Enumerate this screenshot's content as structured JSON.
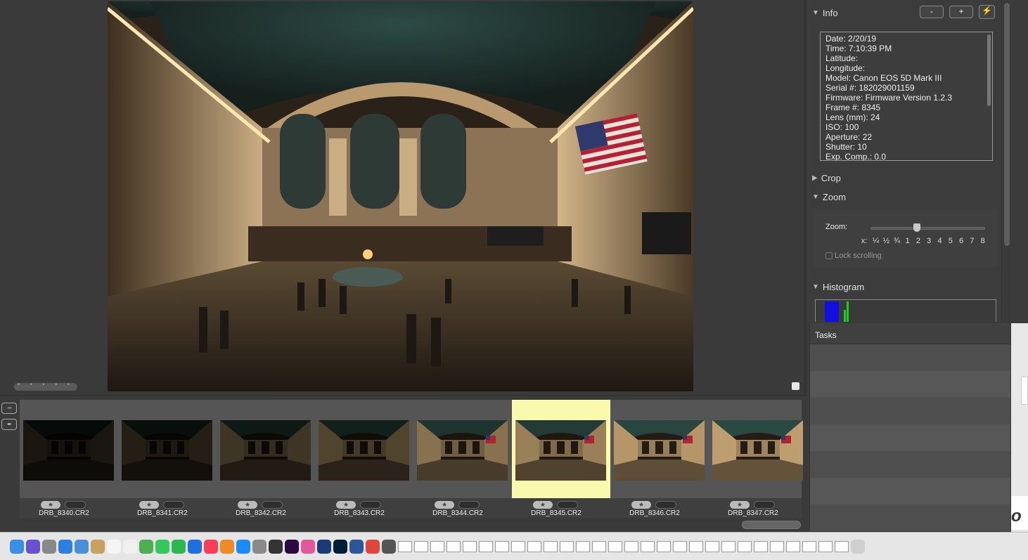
{
  "info_panel": {
    "title": "Info",
    "btn_minus": "-",
    "btn_plus": "+",
    "btn_action": "⚡",
    "lines": [
      "Date: 2/20/19",
      "Time: 7:10:39 PM",
      "Latitude:",
      "Longitude:",
      "Model: Canon EOS 5D Mark III",
      "Serial #: 182029001159",
      "Firmware: Firmware Version 1.2.3",
      "Frame #: 8345",
      "Lens (mm): 24",
      "ISO: 100",
      "Aperture: 22",
      "Shutter: 10",
      "Exp. Comp.: 0.0"
    ]
  },
  "crop_panel": {
    "title": "Crop"
  },
  "zoom_panel": {
    "title": "Zoom",
    "label": "Zoom:",
    "prefix": "x:",
    "ticks": [
      "¼",
      "½",
      "¾",
      "1",
      "2",
      "3",
      "4",
      "5",
      "6",
      "7",
      "8"
    ],
    "lock_label": "Lock scrolling"
  },
  "histogram_panel": {
    "title": "Histogram"
  },
  "tasks_panel": {
    "title": "Tasks"
  },
  "filmstrip": {
    "selected_index": 5,
    "items": [
      {
        "name": "DRB_8340.CR2",
        "brightness": 0.15
      },
      {
        "name": "DRB_8341.CR2",
        "brightness": 0.2
      },
      {
        "name": "DRB_8342.CR2",
        "brightness": 0.35
      },
      {
        "name": "DRB_8343.CR2",
        "brightness": 0.45
      },
      {
        "name": "DRB_8344.CR2",
        "brightness": 0.75
      },
      {
        "name": "DRB_8345.CR2",
        "brightness": 0.85
      },
      {
        "name": "DRB_8346.CR2",
        "brightness": 1.0
      },
      {
        "name": "DRB_8347.CR2",
        "brightness": 1.05
      }
    ]
  },
  "dock_icons": [
    "finder-icon",
    "siri-icon",
    "launchpad-icon",
    "safari-icon",
    "mail-icon",
    "notes-icon",
    "calendar-icon",
    "reminders-icon",
    "maps-icon",
    "messages-icon",
    "facetime-icon",
    "keynote-icon",
    "music-icon",
    "books-icon",
    "appstore-icon",
    "system-preferences-icon",
    "final-cut-icon",
    "premiere-icon",
    "photos-icon",
    "bbedit-icon",
    "photoshop-icon",
    "word-icon",
    "chrome-icon",
    "settings-icon"
  ]
}
